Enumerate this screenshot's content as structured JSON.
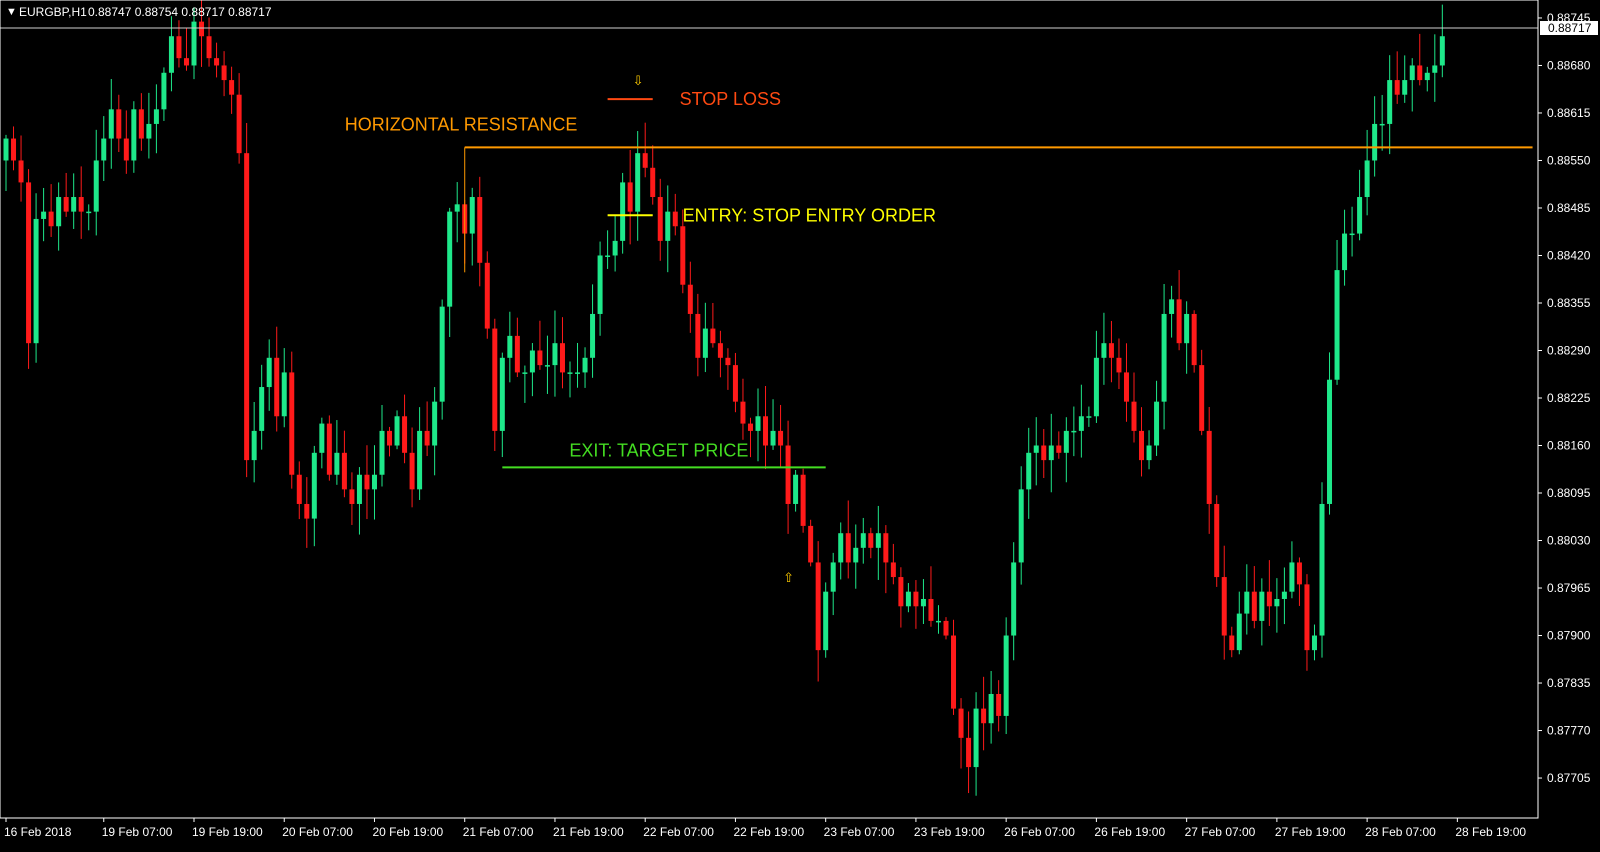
{
  "header": {
    "symbol": "EURGBP,H1",
    "ohlc": "0.88747 0.88754 0.88717 0.88717",
    "menu_glyph": "▼"
  },
  "colors": {
    "background": "#000000",
    "bull": "#1ee88a",
    "bear": "#ff1a1a",
    "axis": "#ffffff",
    "resistance": "#ff9900",
    "stop_loss": "#ff4a12",
    "entry": "#ffff00",
    "target": "#44dd22",
    "arrow": "#ffcc00"
  },
  "chart_data": {
    "type": "candlestick",
    "ylim": [
      0.8769,
      0.8876
    ],
    "current_price": "0.88717",
    "y_ticks": [
      "0.88745",
      "0.88680",
      "0.88615",
      "0.88550",
      "0.88485",
      "0.88420",
      "0.88355",
      "0.88290",
      "0.88225",
      "0.88160",
      "0.88095",
      "0.88030",
      "0.87965",
      "0.87900",
      "0.87835",
      "0.87770",
      "0.87705"
    ],
    "x_ticks": [
      {
        "label": "16 Feb 2018",
        "index": 0
      },
      {
        "label": "19 Feb 07:00",
        "index": 13
      },
      {
        "label": "19 Feb 19:00",
        "index": 25
      },
      {
        "label": "20 Feb 07:00",
        "index": 37
      },
      {
        "label": "20 Feb 19:00",
        "index": 49
      },
      {
        "label": "21 Feb 07:00",
        "index": 61
      },
      {
        "label": "21 Feb 19:00",
        "index": 73
      },
      {
        "label": "22 Feb 07:00",
        "index": 85
      },
      {
        "label": "22 Feb 19:00",
        "index": 97
      },
      {
        "label": "23 Feb 07:00",
        "index": 109
      },
      {
        "label": "23 Feb 19:00",
        "index": 121
      },
      {
        "label": "26 Feb 07:00",
        "index": 133
      },
      {
        "label": "26 Feb 19:00",
        "index": 145
      },
      {
        "label": "27 Feb 07:00",
        "index": 157
      },
      {
        "label": "27 Feb 19:00",
        "index": 169
      },
      {
        "label": "28 Feb 07:00",
        "index": 181
      },
      {
        "label": "28 Feb 19:00",
        "index": 193
      }
    ],
    "closes": [
      0.8858,
      0.8855,
      0.8852,
      0.883,
      0.8847,
      0.8848,
      0.8846,
      0.885,
      0.8848,
      0.885,
      0.8848,
      0.8848,
      0.8855,
      0.8858,
      0.8862,
      0.8858,
      0.8855,
      0.8862,
      0.8858,
      0.886,
      0.8862,
      0.8867,
      0.8872,
      0.8869,
      0.8868,
      0.8874,
      0.8872,
      0.8869,
      0.8868,
      0.8866,
      0.8864,
      0.8856,
      0.8814,
      0.8818,
      0.8824,
      0.8828,
      0.882,
      0.8826,
      0.8812,
      0.8808,
      0.8806,
      0.8815,
      0.8819,
      0.8812,
      0.8815,
      0.881,
      0.8808,
      0.8812,
      0.881,
      0.8812,
      0.8818,
      0.8816,
      0.882,
      0.8815,
      0.881,
      0.8818,
      0.8816,
      0.8822,
      0.8835,
      0.8848,
      0.8849,
      0.8845,
      0.885,
      0.8841,
      0.8832,
      0.8818,
      0.8828,
      0.8831,
      0.8826,
      0.8826,
      0.8829,
      0.8827,
      0.8827,
      0.883,
      0.8826,
      0.8826,
      0.8826,
      0.8828,
      0.8834,
      0.8842,
      0.8842,
      0.8844,
      0.8852,
      0.8848,
      0.8856,
      0.8854,
      0.885,
      0.8844,
      0.8848,
      0.8846,
      0.8838,
      0.8834,
      0.8828,
      0.8832,
      0.883,
      0.8828,
      0.8827,
      0.8822,
      0.8819,
      0.8818,
      0.882,
      0.8816,
      0.8818,
      0.8816,
      0.8808,
      0.8812,
      0.8805,
      0.88,
      0.8788,
      0.8796,
      0.88,
      0.8804,
      0.88,
      0.8802,
      0.8804,
      0.8802,
      0.8804,
      0.88,
      0.8798,
      0.8794,
      0.8796,
      0.8794,
      0.8795,
      0.8792,
      0.8792,
      0.879,
      0.878,
      0.8776,
      0.8772,
      0.878,
      0.8778,
      0.8782,
      0.8779,
      0.879,
      0.88,
      0.881,
      0.8815,
      0.8816,
      0.8814,
      0.8816,
      0.8815,
      0.8818,
      0.8818,
      0.882,
      0.882,
      0.8828,
      0.883,
      0.8828,
      0.8826,
      0.8822,
      0.8818,
      0.8814,
      0.8816,
      0.8822,
      0.8834,
      0.8836,
      0.883,
      0.8834,
      0.8827,
      0.8818,
      0.8808,
      0.8798,
      0.879,
      0.8788,
      0.8793,
      0.8796,
      0.8792,
      0.8796,
      0.8794,
      0.8795,
      0.8796,
      0.88,
      0.8797,
      0.8788,
      0.879,
      0.8808,
      0.8825,
      0.884,
      0.8845,
      0.8845,
      0.885,
      0.8855,
      0.886,
      0.886,
      0.8866,
      0.8864,
      0.8866,
      0.8868,
      0.8866,
      0.8867,
      0.8868,
      0.8872
    ],
    "trend_tone": "mixed",
    "annotations": [
      {
        "label": "HORIZONTAL RESISTANCE",
        "price": 0.88568,
        "from_index": 61,
        "to_index": 203,
        "color_key": "resistance"
      },
      {
        "label": "STOP LOSS",
        "price": 0.88634,
        "from_index": 80,
        "to_index": 86,
        "color_key": "stop_loss"
      },
      {
        "label": "ENTRY: STOP ENTRY ORDER",
        "price": 0.88475,
        "from_index": 80,
        "to_index": 86,
        "color_key": "entry"
      },
      {
        "label": "EXIT: TARGET PRICE",
        "price": 0.8813,
        "from_index": 66,
        "to_index": 109,
        "color_key": "target"
      }
    ],
    "arrows": [
      {
        "direction": "down",
        "glyph": "⇩",
        "index": 84,
        "price": 0.8866
      },
      {
        "direction": "up",
        "glyph": "⇧",
        "index": 104,
        "price": 0.8798
      }
    ]
  }
}
